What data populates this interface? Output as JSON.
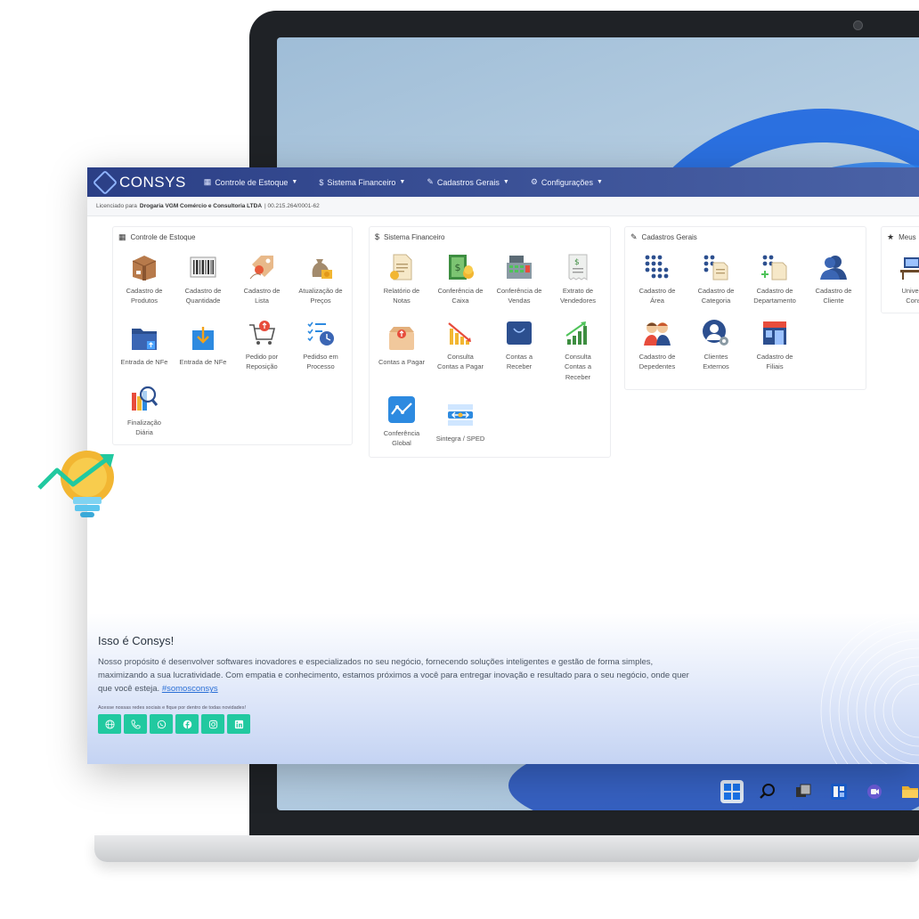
{
  "brand": {
    "name": "CONSYS"
  },
  "nav": [
    {
      "icon": "warehouse-icon",
      "label": "Controle de Estoque"
    },
    {
      "icon": "dollar-icon",
      "label": "Sistema Financeiro"
    },
    {
      "icon": "edit-icon",
      "label": "Cadastros Gerais"
    },
    {
      "icon": "cogs-icon",
      "label": "Configurações"
    }
  ],
  "license": {
    "prefix": "Licenciado para",
    "company": "Drogaria VGM Comércio e Consultoria LTDA",
    "cnpj": "| 00.215.264/0001-62"
  },
  "panels": {
    "estoque": {
      "title": "Controle de Estoque",
      "tiles": [
        {
          "l1": "Cadastro de",
          "l2": "Produtos",
          "icon": "box-icon"
        },
        {
          "l1": "Cadastro de",
          "l2": "Quantidade",
          "icon": "barcode-icon"
        },
        {
          "l1": "Cadastro de",
          "l2": "Lista",
          "icon": "tag-icon"
        },
        {
          "l1": "Atualização de",
          "l2": "Preços",
          "icon": "money-bag-icon"
        },
        {
          "l1": "Entrada de NFe",
          "l2": "",
          "icon": "folder-upload-icon"
        },
        {
          "l1": "Entrada de NFe",
          "l2": "",
          "icon": "download-icon"
        },
        {
          "l1": "Pedido por",
          "l2": "Reposição",
          "icon": "cart-icon"
        },
        {
          "l1": "Pedidso em",
          "l2": "Processo",
          "icon": "checklist-clock-icon"
        },
        {
          "l1": "Finalização",
          "l2": "Diária",
          "icon": "report-search-icon"
        }
      ]
    },
    "financeiro": {
      "title": "Sistema Financeiro",
      "tiles": [
        {
          "l1": "Relatório de",
          "l2": "Notas",
          "icon": "document-icon"
        },
        {
          "l1": "Conferência de",
          "l2": "Caixa",
          "icon": "cash-icon"
        },
        {
          "l1": "Conferência de",
          "l2": "Vendas",
          "icon": "register-icon"
        },
        {
          "l1": "Extrato de",
          "l2": "Vendedores",
          "icon": "receipt-icon"
        },
        {
          "l1": "Contas a Pagar",
          "l2": "",
          "icon": "package-icon"
        },
        {
          "l1": "Consulta",
          "l2": "Contas a Pagar",
          "icon": "chart-down-icon"
        },
        {
          "l1": "Contas a",
          "l2": "Receber",
          "icon": "bag-icon"
        },
        {
          "l1": "Consulta",
          "l2": "Contas a",
          "l3": "Receber",
          "icon": "chart-up-icon"
        },
        {
          "l1": "Conferência",
          "l2": "Global",
          "icon": "trend-icon"
        },
        {
          "l1": "Sintegra / SPED",
          "l2": "",
          "icon": "sync-icon"
        }
      ]
    },
    "cadastros": {
      "title": "Cadastros Gerais",
      "tiles": [
        {
          "l1": "Cadastro de",
          "l2": "Área",
          "icon": "dots-grid-icon"
        },
        {
          "l1": "Cadastro de",
          "l2": "Categoria",
          "icon": "dots-doc-icon"
        },
        {
          "l1": "Cadastro de",
          "l2": "Departamento",
          "icon": "dots-plus-icon"
        },
        {
          "l1": "Cadastro de",
          "l2": "Cliente",
          "icon": "user-icon"
        },
        {
          "l1": "Cadastro de",
          "l2": "Depedentes",
          "icon": "users-icon"
        },
        {
          "l1": "Clientes",
          "l2": "Externos",
          "icon": "user-gear-icon"
        },
        {
          "l1": "Cadastro de",
          "l2": "Filiais",
          "icon": "store-icon"
        }
      ]
    },
    "meus": {
      "title": "Meus",
      "tiles": [
        {
          "l1": "Universi",
          "l2": "Cons",
          "icon": "desk-icon"
        }
      ]
    }
  },
  "about": {
    "title": "Isso é Consys!",
    "text": "Nosso propósito é desenvolver softwares inovadores e especializados no seu negócio, fornecendo soluções inteligentes e gestão de forma simples, maximizando a sua lucratividade. Com empatia e conhecimento, estamos próximos a você para entregar inovação e resultado para o seu negócio, onde quer que você esteja.",
    "hashtag": "#somosconsys",
    "social_caption": "Acesse nossas redes sociais e fique por dentro de todas novidades!",
    "socials": [
      "globe-icon",
      "phone-icon",
      "whatsapp-icon",
      "facebook-icon",
      "instagram-icon",
      "linkedin-icon"
    ]
  },
  "colors": {
    "navbar": "#2b3f86",
    "accent": "#21c9a0",
    "link": "#2a6fd6"
  }
}
